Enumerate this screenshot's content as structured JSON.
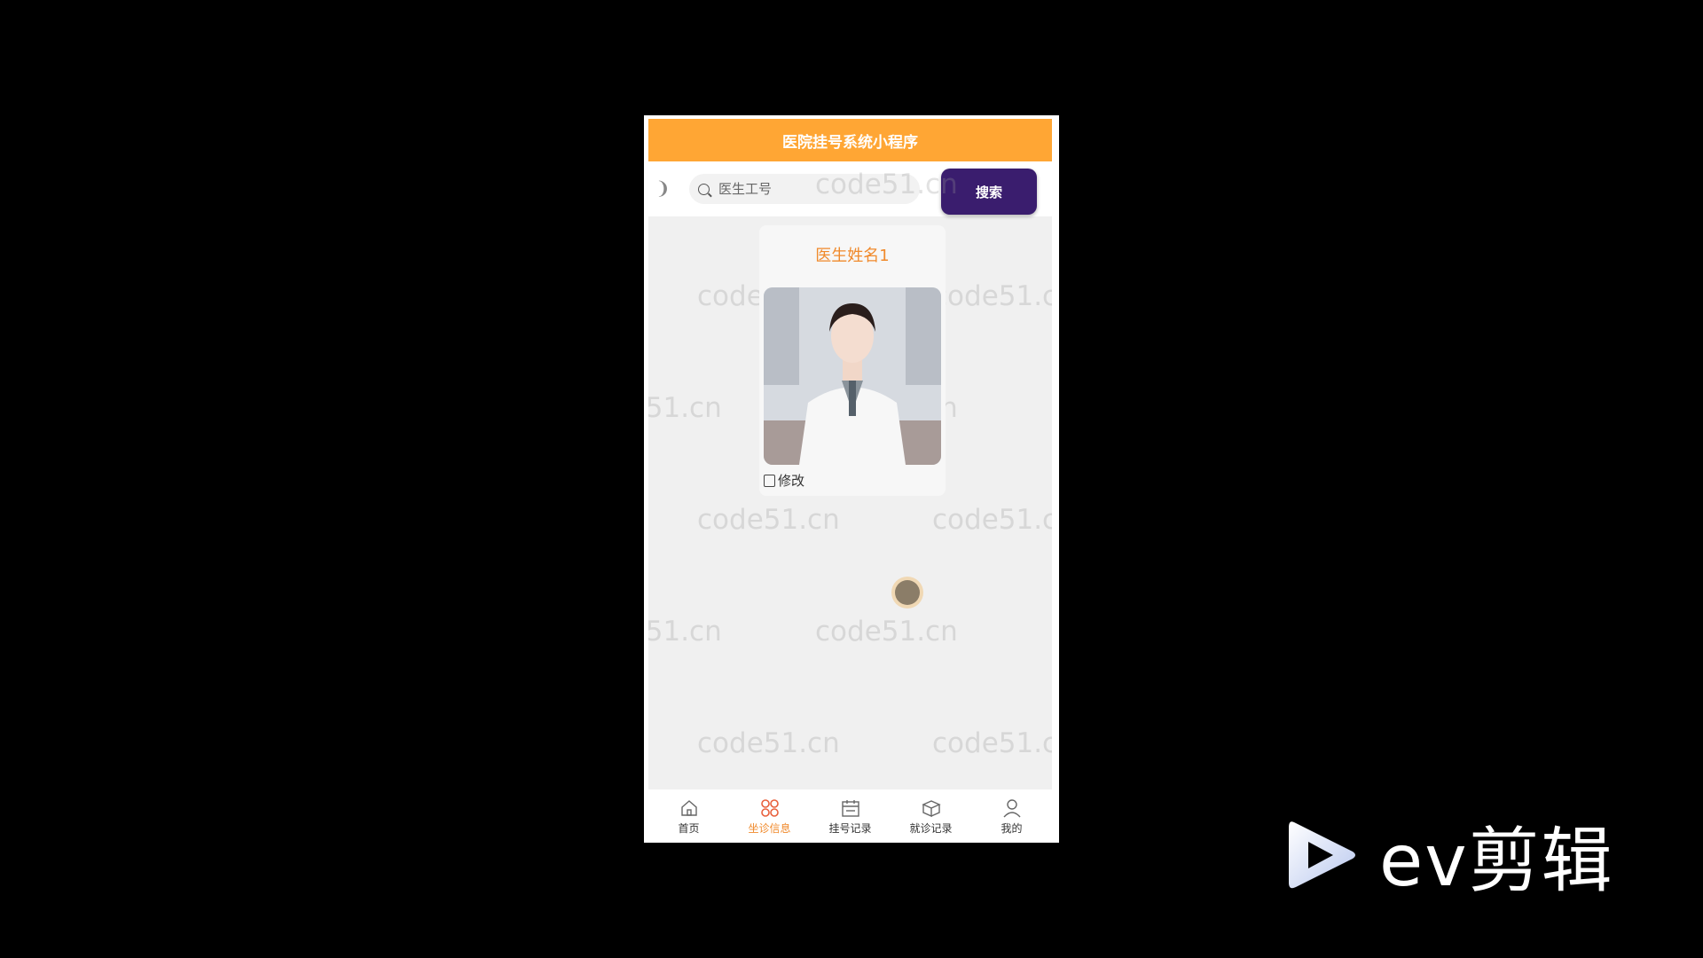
{
  "app": {
    "title": "医院挂号系统小程序"
  },
  "search": {
    "placeholder": "医生工号",
    "button_label": "搜索"
  },
  "card": {
    "doctor_name": "医生姓名1",
    "edit_label": "修改"
  },
  "watermark": "code51.cn",
  "tabbar": {
    "items": [
      {
        "label": "首页",
        "icon": "home-icon",
        "active": false
      },
      {
        "label": "坐诊信息",
        "icon": "grid-icon",
        "active": true
      },
      {
        "label": "挂号记录",
        "icon": "calendar-icon",
        "active": false
      },
      {
        "label": "就诊记录",
        "icon": "box-icon",
        "active": false
      },
      {
        "label": "我的",
        "icon": "user-icon",
        "active": false
      }
    ]
  },
  "overlay_logo": {
    "text": "ev剪辑"
  },
  "colors": {
    "header": "#ffa634",
    "search_button": "#3a1d6e",
    "accent": "#f08a2c"
  }
}
